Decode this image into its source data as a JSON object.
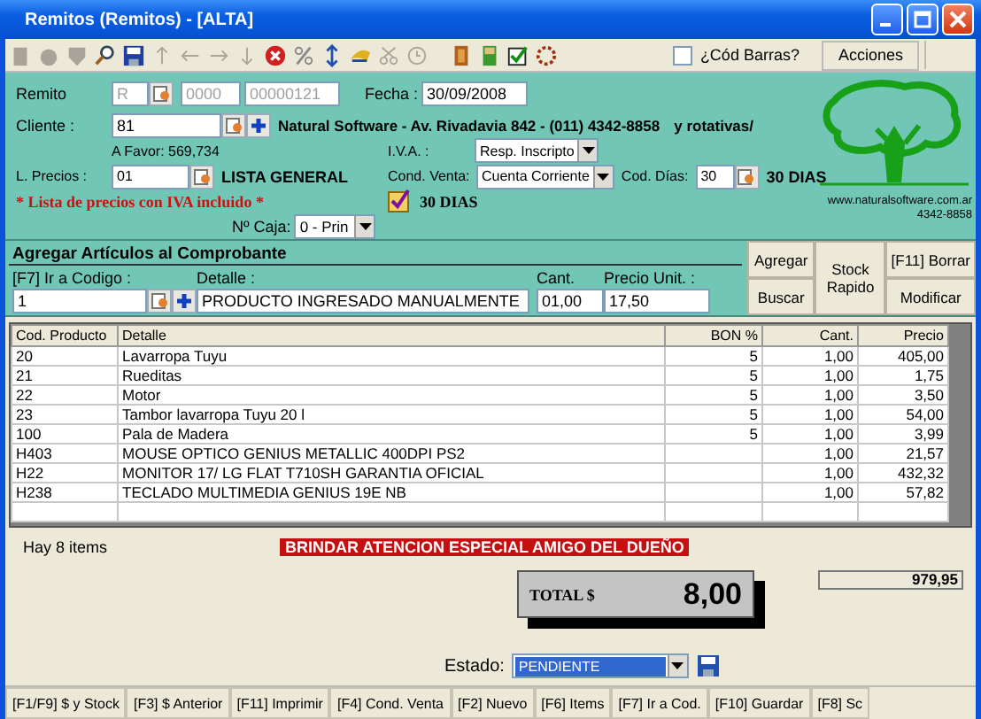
{
  "window": {
    "title": "Remitos  (Remitos) - [ALTA]"
  },
  "toolbar": {
    "barcode_checkbox": {
      "label": "¿Cód Barras?",
      "checked": false
    },
    "actions_button": "Acciones"
  },
  "header": {
    "remito": {
      "label": "Remito",
      "letter": "R",
      "branch": "0000",
      "number": "00000121",
      "disabled": true
    },
    "fecha": {
      "label": "Fecha :",
      "value": "30/09/2008"
    },
    "cliente": {
      "label": "Cliente :",
      "value": "81",
      "name": "Natural Software - Av. Rivadavia 842 - (011)  4342-8858",
      "extra": "y rotativas/",
      "balance": "A Favor: 569,734"
    },
    "iva": {
      "label": "I.V.A. :",
      "value": "Resp. Inscripto"
    },
    "lista": {
      "label": "L. Precios :",
      "value": "01",
      "name": "LISTA GENERAL",
      "note": "* Lista de precios con IVA incluido *"
    },
    "cond_venta": {
      "label": "Cond. Venta:",
      "value": "Cuenta Corriente"
    },
    "cod_dias": {
      "label": "Cod. Días:",
      "value": "30",
      "name": "30 DIAS"
    },
    "dias_check": {
      "checked": true,
      "label": "30 DIAS"
    },
    "caja": {
      "label": "Nº Caja:",
      "value": "0 - Prin"
    },
    "logo": {
      "url": "www.naturalsoftware.com.ar",
      "phone": "4342-8858"
    }
  },
  "add_items": {
    "title": "Agregar Artículos al Comprobante",
    "code": {
      "label": "[F7] Ir a Codigo :",
      "value": "1"
    },
    "detail": {
      "label": "Detalle :",
      "value": "PRODUCTO INGRESADO MANUALMENTE"
    },
    "quantity": {
      "label": "Cant.",
      "value": "01,00"
    },
    "price": {
      "label": "Precio Unit. :",
      "value": "17,50"
    },
    "buttons": {
      "add": "Agregar",
      "search": "Buscar",
      "stock": "Stock Rapido",
      "delete": "[F11] Borrar",
      "modify": "Modificar"
    }
  },
  "table": {
    "columns": [
      "Cod. Producto",
      "Detalle",
      "BON %",
      "Cant.",
      "Precio"
    ],
    "rows": [
      {
        "code": "20",
        "detail": "Lavarropa Tuyu",
        "bon": "5",
        "qty": "1,00",
        "price": "405,00"
      },
      {
        "code": "21",
        "detail": "Rueditas",
        "bon": "5",
        "qty": "1,00",
        "price": "1,75"
      },
      {
        "code": "22",
        "detail": "Motor",
        "bon": "5",
        "qty": "1,00",
        "price": "3,50"
      },
      {
        "code": "23",
        "detail": "Tambor lavarropa Tuyu 20 l",
        "bon": "5",
        "qty": "1,00",
        "price": "54,00"
      },
      {
        "code": "100",
        "detail": "Pala de Madera",
        "bon": "5",
        "qty": "1,00",
        "price": "3,99"
      },
      {
        "code": "H403",
        "detail": "MOUSE OPTICO GENIUS METALLIC 400DPI PS2",
        "qty": "1,00",
        "price": "21,57"
      },
      {
        "code": "H22",
        "detail": "MONITOR 17/ LG FLAT T710SH GARANTIA OFICIAL",
        "qty": "1,00",
        "price": "432,32"
      },
      {
        "code": "H238",
        "detail": "TECLADO MULTIMEDIA GENIUS 19E NB",
        "qty": "1,00",
        "price": "57,82"
      }
    ]
  },
  "footer": {
    "items_count": "Hay 8 items",
    "banner": "BRINDAR ATENCION ESPECIAL AMIGO DEL DUEÑO",
    "total_label": "TOTAL $",
    "total": "8,00",
    "subtotal": "979,95",
    "estado": {
      "label": "Estado:",
      "value": "PENDIENTE"
    }
  },
  "tabs": [
    "[F1/F9] $ y Stock",
    "[F3] $ Anterior",
    "[F11] Imprimir",
    "[F4] Cond. Venta",
    "[F2] Nuevo",
    "[F6] Items",
    "[F7] Ir a Cod.",
    "[F10] Guardar",
    "[F8] Sc"
  ]
}
